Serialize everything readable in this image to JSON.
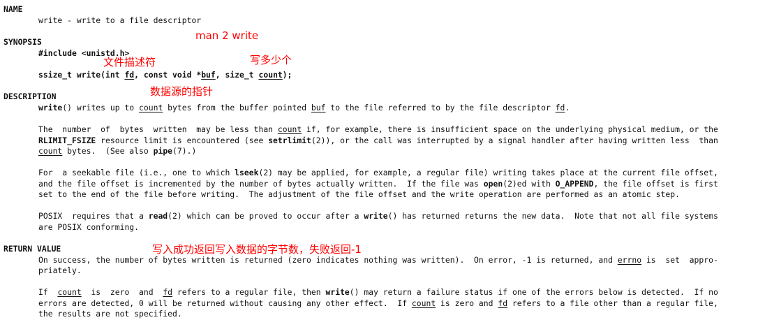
{
  "sections": {
    "name": "NAME",
    "synopsis": "SYNOPSIS",
    "description": "DESCRIPTION",
    "return_value": "RETURN VALUE"
  },
  "name_line": "write - write to a file descriptor",
  "synopsis": {
    "include": "#include <unistd.h>",
    "sig_prefix": "ssize_t write(int ",
    "sig_fd": "fd",
    "sig_mid1": ", const void *",
    "sig_buf": "buf",
    "sig_mid2": ", size_t ",
    "sig_count": "count",
    "sig_end": ");"
  },
  "annotations": {
    "man": "man 2 write",
    "fd": "文件描述符",
    "count": "写多少个",
    "buf": "数据源的指针",
    "ret": "写入成功返回写入数据的字节数，失败返回-1"
  },
  "desc1": {
    "write": "write",
    "a": "() writes up to ",
    "count": "count",
    "b": " bytes from the buffer pointed ",
    "buf": "buf",
    "c": " to the file referred to by the file descriptor ",
    "fd": "fd",
    "d": "."
  },
  "desc2": {
    "l1a": "The  number  of  bytes  written  may be less than ",
    "l1count": "count",
    "l1b": " if, for example, there is insufficient space on the underlying physical medium, or the",
    "l2rl": "RLIMIT_FSIZE",
    "l2a": " resource limit is encountered (see ",
    "l2setrl": "setrlimit",
    "l2b": "(2)), or the call was interrupted by a signal handler after having written less  than",
    "l3count": "count",
    "l3a": " bytes.  (See also ",
    "l3pipe": "pipe",
    "l3b": "(7).)"
  },
  "desc3": {
    "l1a": "For  a seekable file (i.e., one to which ",
    "l1lseek": "lseek",
    "l1b": "(2) may be applied, for example, a regular file) writing takes place at the current file offset,",
    "l2a": "and the file offset is incremented by the number of bytes actually written.  If the file was ",
    "l2open": "open",
    "l2b": "(2)ed with ",
    "l2oa": "O_APPEND",
    "l2c": ", the file offset is first",
    "l3": "set to the end of the file before writing.  The adjustment of the file offset and the write operation are performed as an atomic step."
  },
  "desc4": {
    "l1a": "POSIX  requires that a ",
    "l1read": "read",
    "l1b": "(2) which can be proved to occur after a ",
    "l1write": "write",
    "l1c": "() has returned returns the new data.  Note that not all file systems",
    "l2": "are POSIX conforming."
  },
  "ret1": {
    "l1a": "On success, the number of bytes written is returned (zero indicates nothing was written).  On error, -1 is returned, and ",
    "l1errno": "errno",
    "l1b": " is  set  appro-",
    "l2": "priately."
  },
  "ret2": {
    "l1a": "If  ",
    "l1count": "count",
    "l1b": "  is  zero  and  ",
    "l1fd": "fd",
    "l1c": " refers to a regular file, then ",
    "l1write": "write",
    "l1d": "() may return a failure status if one of the errors below is detected.  If no",
    "l2a": "errors are detected, 0 will be returned without causing any other effect.  If ",
    "l2count": "count",
    "l2b": " is zero and ",
    "l2fd": "fd",
    "l2c": " refers to a file other than a regular file,",
    "l3": "the results are not specified."
  }
}
